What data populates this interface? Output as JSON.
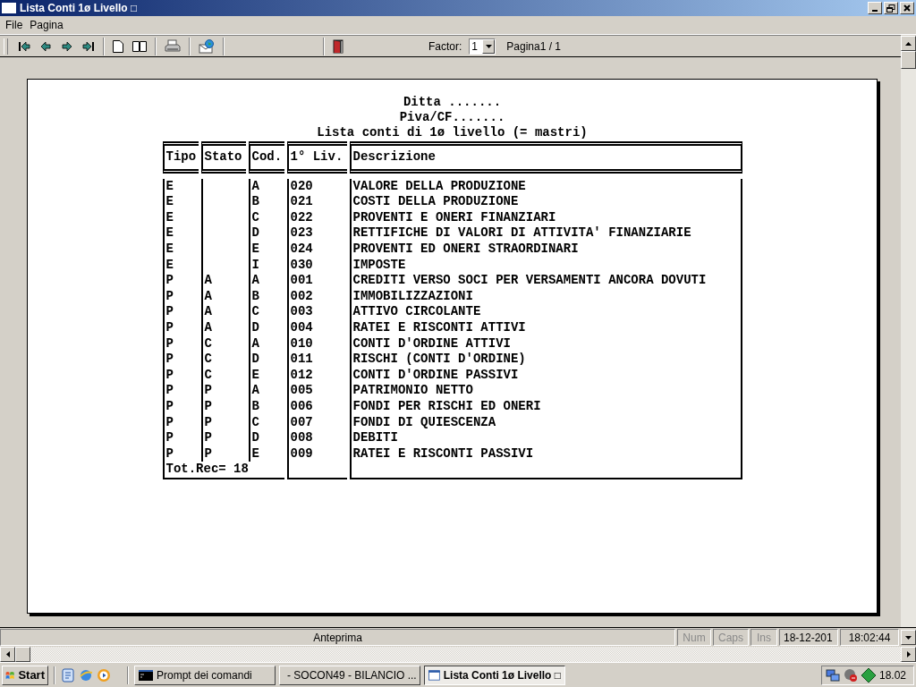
{
  "window": {
    "title": "Lista Conti 1ø Livello □"
  },
  "menu": [
    "File",
    "Pagina"
  ],
  "toolbar": {
    "factor_label": "Factor:",
    "factor_value": "1",
    "page_label": "Pagina1 / 1"
  },
  "report": {
    "header_lines": [
      "Ditta .......",
      "Piva/CF.......",
      "Lista conti di 1ø livello (= mastri)"
    ],
    "columns": [
      "Tipo",
      "Stato",
      "Cod.",
      "1° Liv.",
      "Descrizione"
    ],
    "rows": [
      {
        "tipo": "E",
        "cod": "A",
        "liv": "020",
        "descrizione": "VALORE DELLA PRODUZIONE"
      },
      {
        "tipo": "E",
        "cod": "B",
        "liv": "021",
        "descrizione": "COSTI DELLA PRODUZIONE"
      },
      {
        "tipo": "E",
        "cod": "C",
        "liv": "022",
        "descrizione": "PROVENTI E ONERI FINANZIARI"
      },
      {
        "tipo": "E",
        "cod": "D",
        "liv": "023",
        "descrizione": "RETTIFICHE DI VALORI DI ATTIVITA' FINANZIARIE"
      },
      {
        "tipo": "E",
        "cod": "E",
        "liv": "024",
        "descrizione": "PROVENTI ED ONERI STRAORDINARI"
      },
      {
        "tipo": "E",
        "cod": "I",
        "liv": "030",
        "descrizione": "IMPOSTE"
      },
      {
        "tipo": "P",
        "stato": "A",
        "cod": "A",
        "liv": "001",
        "descrizione": "CREDITI VERSO SOCI PER VERSAMENTI ANCORA DOVUTI"
      },
      {
        "tipo": "P",
        "stato": "A",
        "cod": "B",
        "liv": "002",
        "descrizione": "IMMOBILIZZAZIONI"
      },
      {
        "tipo": "P",
        "stato": "A",
        "cod": "C",
        "liv": "003",
        "descrizione": "ATTIVO CIRCOLANTE"
      },
      {
        "tipo": "P",
        "stato": "A",
        "cod": "D",
        "liv": "004",
        "descrizione": "RATEI E RISCONTI ATTIVI"
      },
      {
        "tipo": "P",
        "stato": "C",
        "cod": "A",
        "liv": "010",
        "descrizione": "CONTI D'ORDINE ATTIVI"
      },
      {
        "tipo": "P",
        "stato": "C",
        "cod": "D",
        "liv": "011",
        "descrizione": "RISCHI (CONTI D'ORDINE)"
      },
      {
        "tipo": "P",
        "stato": "C",
        "cod": "E",
        "liv": "012",
        "descrizione": "CONTI D'ORDINE PASSIVI"
      },
      {
        "tipo": "P",
        "stato": "P",
        "cod": "A",
        "liv": "005",
        "descrizione": "PATRIMONIO NETTO"
      },
      {
        "tipo": "P",
        "stato": "P",
        "cod": "B",
        "liv": "006",
        "descrizione": "FONDI PER RISCHI ED ONERI"
      },
      {
        "tipo": "P",
        "stato": "P",
        "cod": "C",
        "liv": "007",
        "descrizione": "FONDI DI QUIESCENZA"
      },
      {
        "tipo": "P",
        "stato": "P",
        "cod": "D",
        "liv": "008",
        "descrizione": "DEBITI"
      },
      {
        "tipo": "P",
        "stato": "P",
        "cod": "E",
        "liv": "009",
        "descrizione": "RATEI E RISCONTI PASSIVI"
      }
    ],
    "total": "Tot.Rec= 18"
  },
  "status_bar": {
    "text": "Anteprima",
    "indicators": [
      {
        "label": "Num",
        "on": false
      },
      {
        "label": "Caps",
        "on": false
      },
      {
        "label": "Ins",
        "on": false
      }
    ],
    "date": "18-12-201",
    "time": "18:02:44"
  },
  "taskbar": {
    "start": "Start",
    "tasks": [
      {
        "kind": "console",
        "label": "Prompt dei comandi",
        "selected": false
      },
      {
        "kind": "window",
        "label": "- SOCON49 - BILANCIO ...",
        "selected": false
      },
      {
        "kind": "window",
        "label": "Lista Conti 1ø Livello □",
        "selected": true
      }
    ],
    "clock": "18.02"
  }
}
